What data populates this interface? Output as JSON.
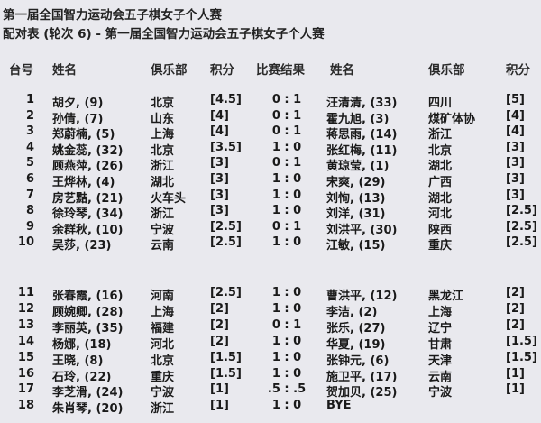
{
  "title_line1": "第一届全国智力运动会五子棋女子个人赛",
  "title_line2": "配对表 (轮次 6) - 第一届全国智力运动会五子棋女子个人赛",
  "headers": {
    "board": "台号",
    "name1": "姓名",
    "club1": "俱乐部",
    "score1": "积分",
    "result": "比赛结果",
    "name2": "姓名",
    "club2": "俱乐部",
    "score2": "积分"
  },
  "pairings": [
    {
      "board": "1",
      "name1": "胡夕, (9)",
      "club1": "北京",
      "score1": "[4.5]",
      "result": "0 : 1",
      "name2": "汪清清, (33)",
      "club2": "四川",
      "score2": "[5]"
    },
    {
      "board": "2",
      "name1": "孙倩, (7)",
      "club1": "山东",
      "score1": "[4]",
      "result": "0 : 1",
      "name2": "霍九旭, (3)",
      "club2": "煤矿体协",
      "score2": "[4]"
    },
    {
      "board": "3",
      "name1": "郑蔚楠, (5)",
      "club1": "上海",
      "score1": "[4]",
      "result": "0 : 1",
      "name2": "蒋思雨, (14)",
      "club2": "浙江",
      "score2": "[4]"
    },
    {
      "board": "4",
      "name1": "姚金蕊, (32)",
      "club1": "北京",
      "score1": "[3.5]",
      "result": "1 : 0",
      "name2": "张红梅, (11)",
      "club2": "北京",
      "score2": "[3]"
    },
    {
      "board": "5",
      "name1": "顾燕萍, (26)",
      "club1": "浙江",
      "score1": "[3]",
      "result": "0 : 1",
      "name2": "黄琼莹, (1)",
      "club2": "湖北",
      "score2": "[3]"
    },
    {
      "board": "6",
      "name1": "王烨林, (4)",
      "club1": "湖北",
      "score1": "[3]",
      "result": "1 : 0",
      "name2": "宋爽, (29)",
      "club2": "广西",
      "score2": "[3]"
    },
    {
      "board": "7",
      "name1": "房艺黠, (21)",
      "club1": "火车头",
      "score1": "[3]",
      "result": "1 : 0",
      "name2": "刘恂, (13)",
      "club2": "湖北",
      "score2": "[3]"
    },
    {
      "board": "8",
      "name1": "徐玲琴, (34)",
      "club1": "浙江",
      "score1": "[3]",
      "result": "1 : 0",
      "name2": "刘洋, (31)",
      "club2": "河北",
      "score2": "[2.5]"
    },
    {
      "board": "9",
      "name1": "余群秋, (10)",
      "club1": "宁波",
      "score1": "[2.5]",
      "result": "0 : 1",
      "name2": "刘洪平, (30)",
      "club2": "陕西",
      "score2": "[2.5]"
    },
    {
      "board": "10",
      "name1": "吴莎, (23)",
      "club1": "云南",
      "score1": "[2.5]",
      "result": "1 : 0",
      "name2": "江敏, (15)",
      "club2": "重庆",
      "score2": "[2.5]"
    },
    {
      "board": "11",
      "name1": "张春霞, (16)",
      "club1": "河南",
      "score1": "[2.5]",
      "result": "1 : 0",
      "name2": "曹洪平, (12)",
      "club2": "黑龙江",
      "score2": "[2]"
    },
    {
      "board": "12",
      "name1": "顾婉卿, (28)",
      "club1": "上海",
      "score1": "[2]",
      "result": "1 : 0",
      "name2": "李洁, (2)",
      "club2": "上海",
      "score2": "[2]"
    },
    {
      "board": "13",
      "name1": "李丽英, (35)",
      "club1": "福建",
      "score1": "[2]",
      "result": "0 : 1",
      "name2": "张乐, (27)",
      "club2": "辽宁",
      "score2": "[2]"
    },
    {
      "board": "14",
      "name1": "杨娜, (18)",
      "club1": "河北",
      "score1": "[2]",
      "result": "1 : 0",
      "name2": "华夏, (19)",
      "club2": "甘肃",
      "score2": "[1.5]"
    },
    {
      "board": "15",
      "name1": "王晓, (8)",
      "club1": "北京",
      "score1": "[1.5]",
      "result": "1 : 0",
      "name2": "张钟元, (6)",
      "club2": "天津",
      "score2": "[1.5]"
    },
    {
      "board": "16",
      "name1": "石玲, (22)",
      "club1": "重庆",
      "score1": "[1.5]",
      "result": "1 : 0",
      "name2": "施卫平, (17)",
      "club2": "云南",
      "score2": "[1]"
    },
    {
      "board": "17",
      "name1": "李芝滑, (24)",
      "club1": "宁波",
      "score1": "[1]",
      "result": ".5 : .5",
      "name2": "贺加贝, (25)",
      "club2": "宁波",
      "score2": "[1]"
    },
    {
      "board": "18",
      "name1": "朱肖琴, (20)",
      "club1": "浙江",
      "score1": "[1]",
      "result": "1 : 0",
      "name2": "BYE",
      "club2": "",
      "score2": ""
    }
  ]
}
